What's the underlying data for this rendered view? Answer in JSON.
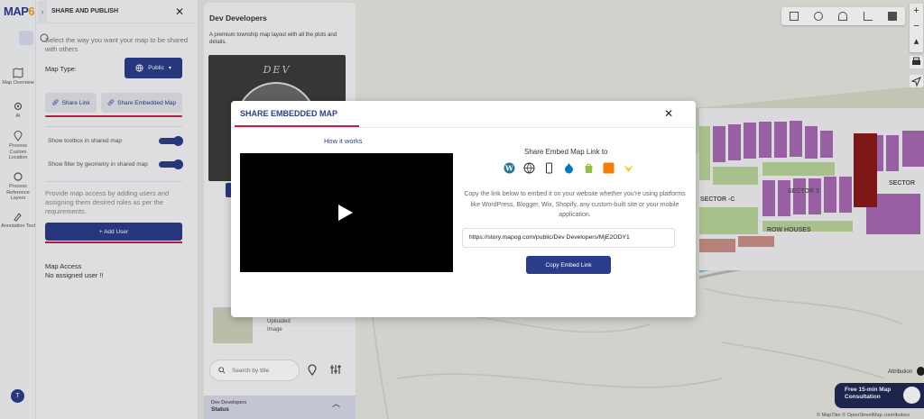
{
  "app": {
    "logo_text": "MAP",
    "logo_six": "6"
  },
  "rail": {
    "items": [
      {
        "label": "Map Overview"
      },
      {
        "label": "AI"
      },
      {
        "label": "Process Custom Location"
      },
      {
        "label": "Process Reference Layers"
      },
      {
        "label": "Annotation Tool"
      }
    ],
    "avatar": "T"
  },
  "share_panel": {
    "title": "SHARE AND PUBLISH",
    "description": "Select the way you want your map to be shared with others",
    "map_type_label": "Map Type:",
    "map_type_value": "Public",
    "tabs": [
      {
        "label": "Share Link"
      },
      {
        "label": "Share Embedded Map"
      }
    ],
    "toggles": [
      {
        "label": "Show toolbox in shared map",
        "on": true
      },
      {
        "label": "Show filter by geometry in shared map",
        "on": true
      }
    ],
    "access_description": "Provide map access by adding users and assigning them desired roles as per the requirements.",
    "add_user_label": "+ Add User",
    "map_access_title": "Map Access",
    "map_access_value": "No assigned user !!"
  },
  "project_card": {
    "title": "Dev Developers",
    "description": "A premium township map layout with all the plots and details.",
    "image_text": "DEV",
    "image_caption": "Uploaded Image",
    "search_placeholder": "Search by title",
    "footer_project": "Dev Developers",
    "footer_label": "Status"
  },
  "map": {
    "labels": [
      "SECTOR 3",
      "SECTOR",
      "SECTOR -C",
      "ROW HOUSES"
    ],
    "attribution": "Attribution",
    "credits": "© MapTiler © OpenStreetMap contributors",
    "consult_line1": "Free 15-min Map",
    "consult_line2": "Consultation"
  },
  "modal": {
    "title": "SHARE EMBEDDED MAP",
    "how_it_works": "How it works",
    "share_title": "Share Embed Map Link to",
    "platform_icons": [
      "wordpress-icon",
      "globe-icon",
      "mobile-icon",
      "drupal-icon",
      "shopify-icon",
      "blogger-icon",
      "wix-icon"
    ],
    "description": "Copy the link below to embed it on your website whether you're using platforms like WordPress, Blogger, Wix, Shopify, any custom-built site or your mobile application.",
    "embed_url": "https://story.mapog.com/public/Dev Developers/MjE2ODY1",
    "copy_button": "Copy Embed Link"
  },
  "colors": {
    "brand": "#2b3d8a",
    "accent": "#c4204e",
    "plot_purple": "#a86ab3",
    "plot_green": "#b9d49a"
  }
}
